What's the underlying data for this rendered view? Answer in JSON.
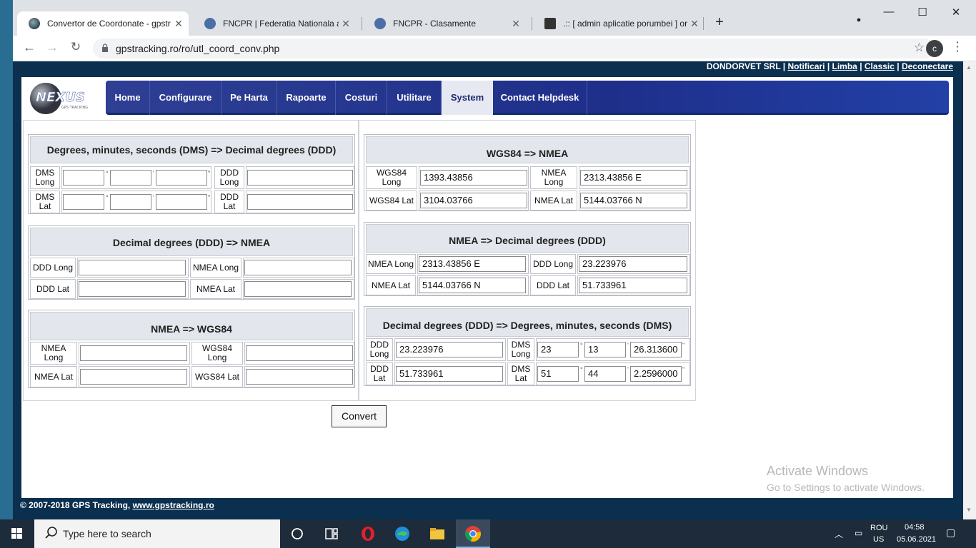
{
  "browser": {
    "tabs": [
      {
        "title": "Convertor de Coordonate - gpstr",
        "active": true
      },
      {
        "title": "FNCPR | Federatia Nationala a Cr"
      },
      {
        "title": "FNCPR - Clasamente"
      },
      {
        "title": ".:: [ admin aplicatie porumbei ] or"
      }
    ],
    "url": "gpstracking.ro/ro/utl_coord_conv.php",
    "profile_initial": "c"
  },
  "account": {
    "company": "DONDORVET SRL",
    "links": [
      "Notificari",
      "Limba",
      "Classic",
      "Deconectare"
    ]
  },
  "nav": {
    "items": [
      "Home",
      "Configurare",
      "Pe Harta",
      "Rapoarte",
      "Costuri",
      "Utilitare",
      "System",
      "Contact Helpdesk"
    ],
    "active": "System"
  },
  "panels": {
    "dms_to_ddd": {
      "title": "Degrees, minutes, seconds (DMS) => Decimal degrees (DDD)",
      "dms_long_label": "DMS Long",
      "dms_lat_label": "DMS Lat",
      "ddd_long_label": "DDD Long",
      "ddd_lat_label": "DDD Lat",
      "deg_unit": "°",
      "min_unit": "'",
      "sec_unit": "\""
    },
    "ddd_to_nmea": {
      "title": "Decimal degrees (DDD) => NMEA",
      "ddd_long_label": "DDD Long",
      "ddd_lat_label": "DDD Lat",
      "nmea_long_label": "NMEA Long",
      "nmea_lat_label": "NMEA Lat"
    },
    "nmea_to_wgs84": {
      "title": "NMEA => WGS84",
      "nmea_long_label": "NMEA Long",
      "nmea_lat_label": "NMEA Lat",
      "wgs_long_label": "WGS84 Long",
      "wgs_lat_label": "WGS84 Lat"
    },
    "wgs84_to_nmea": {
      "title": "WGS84 => NMEA",
      "wgs_long_label": "WGS84 Long",
      "wgs_lat_label": "WGS84 Lat",
      "nmea_long_label": "NMEA Long",
      "nmea_lat_label": "NMEA Lat",
      "wgs_long": "1393.43856",
      "wgs_lat": "3104.03766",
      "nmea_long": "2313.43856 E",
      "nmea_lat": "5144.03766 N"
    },
    "nmea_to_ddd": {
      "title": "NMEA => Decimal degrees (DDD)",
      "nmea_long_label": "NMEA Long",
      "nmea_lat_label": "NMEA Lat",
      "ddd_long_label": "DDD Long",
      "ddd_lat_label": "DDD Lat",
      "nmea_long": "2313.43856 E",
      "nmea_lat": "5144.03766 N",
      "ddd_long": "23.223976",
      "ddd_lat": "51.733961"
    },
    "ddd_to_dms": {
      "title": "Decimal degrees (DDD) => Degrees, minutes, seconds (DMS)",
      "ddd_long_label": "DDD Long",
      "ddd_lat_label": "DDD Lat",
      "dms_long_label": "DMS Long",
      "dms_lat_label": "DMS Lat",
      "ddd_long": "23.223976",
      "ddd_lat": "51.733961",
      "dms_long_deg": "23",
      "dms_long_min": "13",
      "dms_long_sec": "26.313600",
      "dms_lat_deg": "51",
      "dms_lat_min": "44",
      "dms_lat_sec": "2.2596000",
      "deg_unit": "°",
      "min_unit": "'",
      "sec_unit": "\""
    }
  },
  "convert_label": "Convert",
  "footer": {
    "text": "© 2007-2018 GPS Tracking, ",
    "link": "www.gpstracking.ro"
  },
  "watermark": {
    "line1": "Activate Windows",
    "line2": "Go to Settings to activate Windows."
  },
  "taskbar": {
    "search_placeholder": "Type here to search",
    "lang_top": "ROU",
    "lang_bottom": "US",
    "time": "04:58",
    "date": "05.06.2021"
  },
  "colors": {
    "nav_blue": "#1e2f8a",
    "page_bg": "#0b2f4f",
    "taskbar": "#1d2b3a"
  }
}
